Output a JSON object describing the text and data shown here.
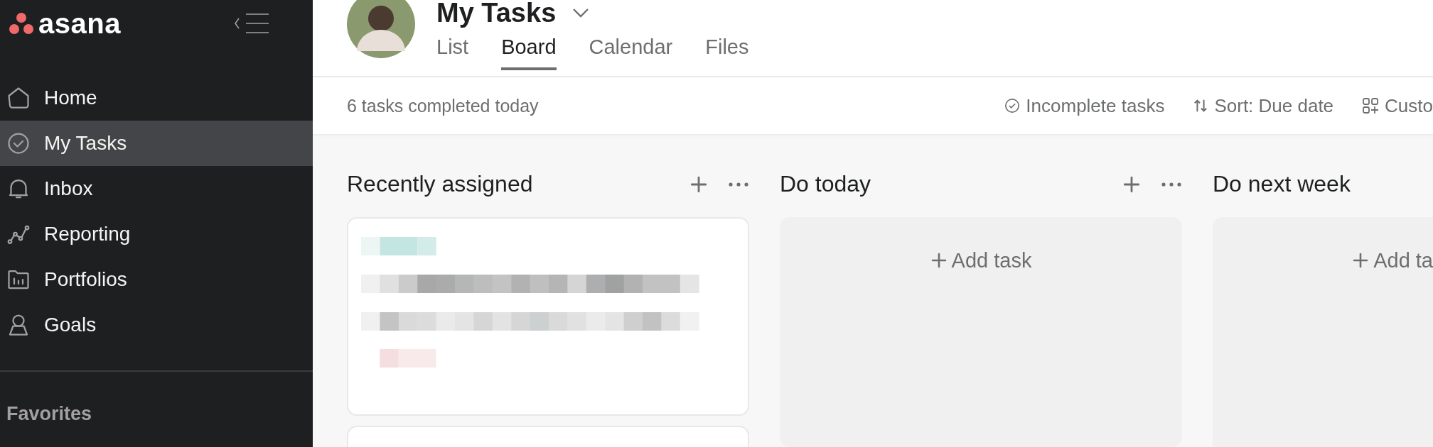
{
  "sidebar": {
    "logo": "asana",
    "items": [
      {
        "label": "Home",
        "selected": false
      },
      {
        "label": "My Tasks",
        "selected": true
      },
      {
        "label": "Inbox",
        "selected": false
      },
      {
        "label": "Reporting",
        "selected": false
      },
      {
        "label": "Portfolios",
        "selected": false
      },
      {
        "label": "Goals",
        "selected": false
      }
    ],
    "section": "Favorites"
  },
  "header": {
    "title": "My Tasks",
    "tabs": [
      {
        "label": "List",
        "selected": false
      },
      {
        "label": "Board",
        "selected": true
      },
      {
        "label": "Calendar",
        "selected": false
      },
      {
        "label": "Files",
        "selected": false
      }
    ]
  },
  "toolbar": {
    "summary": "6 tasks completed today",
    "actions": [
      "Incomplete tasks",
      "Sort: Due date",
      "Custo"
    ]
  },
  "columns": [
    {
      "title": "Recently assigned",
      "clipped": false,
      "cards": [
        {
          "kind": "pixelated"
        },
        {
          "kind": "empty"
        }
      ]
    },
    {
      "title": "Do today",
      "clipped": false,
      "add_task": "Add task"
    },
    {
      "title": "Do next week",
      "clipped": true,
      "add_task": "Add ta"
    }
  ]
}
